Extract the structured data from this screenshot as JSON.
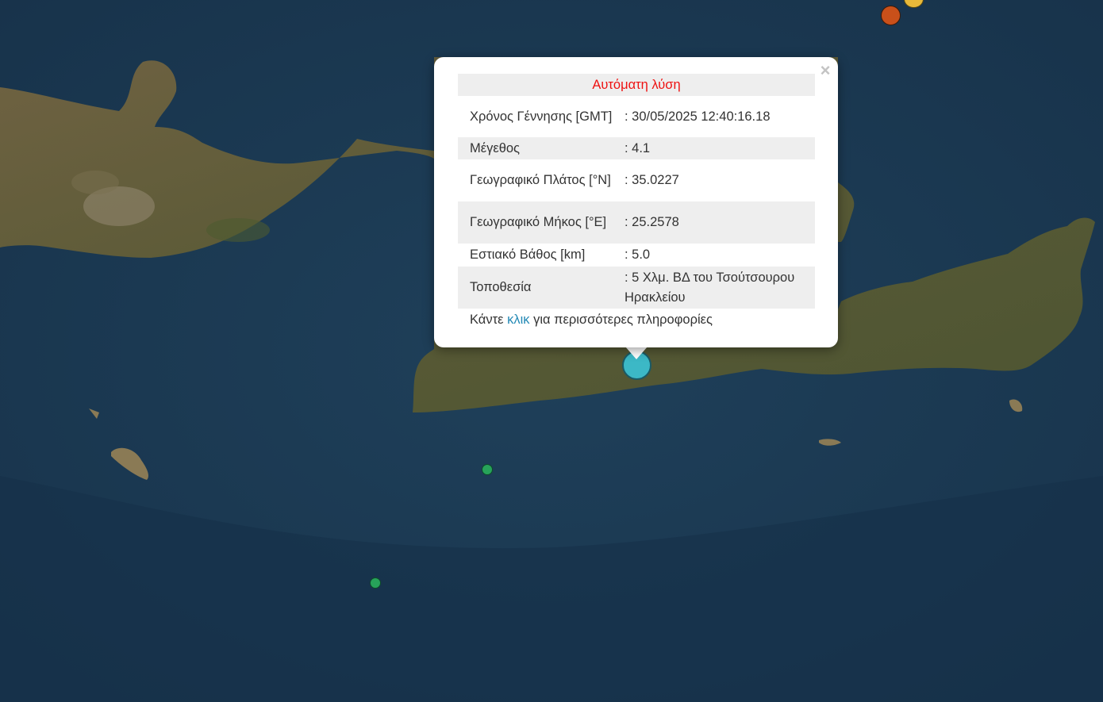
{
  "map": {
    "markers": [
      {
        "name": "earthquake-marker-orange",
        "color": "#c9501a"
      },
      {
        "name": "earthquake-marker-yellow",
        "color": "#e8b93a"
      },
      {
        "name": "earthquake-marker-green",
        "color": "#27a35a"
      },
      {
        "name": "earthquake-marker-green",
        "color": "#27a35a"
      },
      {
        "name": "earthquake-marker-selected",
        "color": "#3cb8c6"
      }
    ]
  },
  "popup": {
    "close_icon": "close-icon",
    "title": "Αυτόματη λύση",
    "rows": {
      "time": {
        "label": "Χρόνος Γέννησης [GMT]",
        "value": ": 30/05/2025 12:40:16.18"
      },
      "magnitude": {
        "label": "Μέγεθος",
        "value": ": 4.1"
      },
      "latitude": {
        "label": "Γεωγραφικό Πλάτος [°N]",
        "value": ": 35.0227"
      },
      "longitude": {
        "label": "Γεωγραφικό Μήκος [°E]",
        "value": ": 25.2578"
      },
      "depth": {
        "label": "Εστιακό Βάθος [km]",
        "value": ": 5.0"
      },
      "location": {
        "label": "Τοποθεσία",
        "value": ": 5 Χλμ. ΒΔ του Τσούτσουρου Ηρακλείου"
      }
    },
    "more_prefix": "Κάντε ",
    "more_link": "κλικ",
    "more_suffix": " για περισσότερες πληροφορίες"
  }
}
